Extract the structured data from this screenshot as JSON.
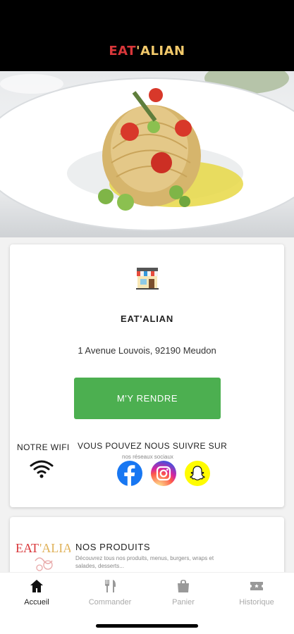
{
  "app": {
    "brand_part1": "EAT",
    "brand_part2": "'ALIAN"
  },
  "restaurant": {
    "name": "EAT'ALIAN",
    "address": "1 Avenue Louvois, 92190 Meudon",
    "directions_label": "M'Y RENDRE"
  },
  "wifi": {
    "title": "NOTRE WIFI",
    "icon": "wifi-icon"
  },
  "social": {
    "title": "VOUS POUVEZ NOUS SUIVRE SUR",
    "subtitle": "nos réseaux sociaux",
    "networks": [
      "facebook-icon",
      "instagram-icon",
      "snapchat-icon"
    ]
  },
  "products": {
    "title": "NOS PRODUITS",
    "description": "Découvrez tous nos produits, menus, burgers, wraps et salades, desserts..."
  },
  "nav": {
    "items": [
      {
        "label": "Accueil",
        "icon": "home-icon",
        "active": true
      },
      {
        "label": "Commander",
        "icon": "cutlery-icon",
        "active": false
      },
      {
        "label": "Panier",
        "icon": "bag-icon",
        "active": false
      },
      {
        "label": "Historique",
        "icon": "ticket-icon",
        "active": false
      }
    ]
  },
  "colors": {
    "brand_red": "#d9373a",
    "brand_gold": "#f2c96b",
    "button_green": "#4caf50",
    "topbar": "#000000"
  }
}
